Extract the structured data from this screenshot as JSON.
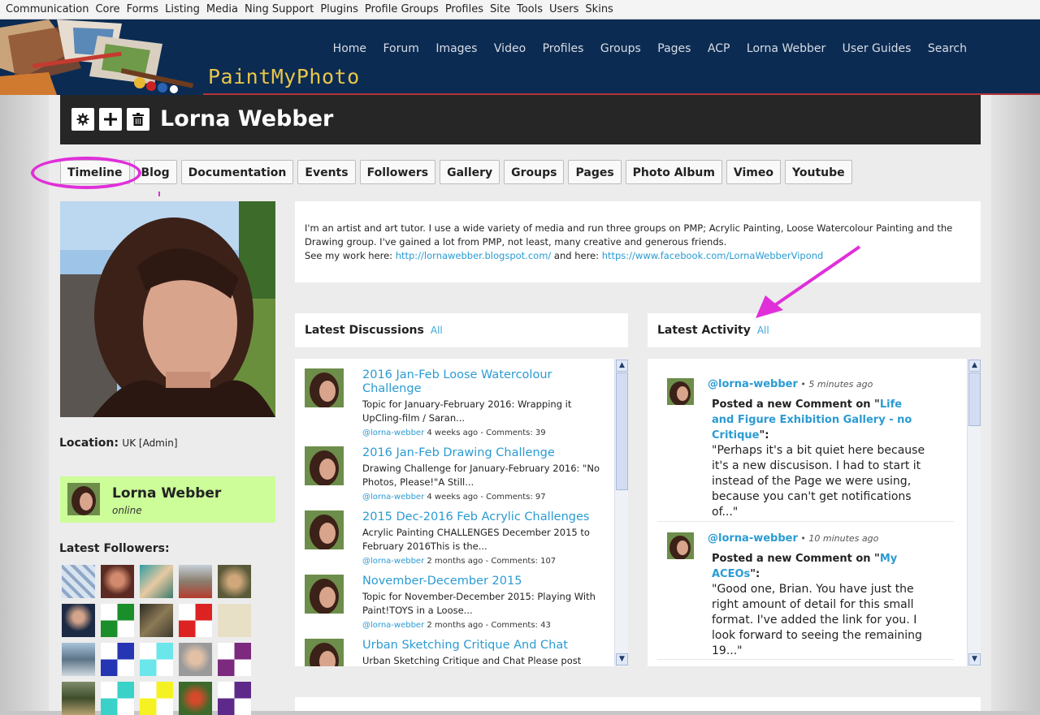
{
  "adminbar": {
    "items": [
      "Communication",
      "Core",
      "Forms",
      "Listing",
      "Media",
      "Ning Support",
      "Plugins",
      "Profile Groups",
      "Profiles",
      "Site",
      "Tools",
      "Users",
      "Skins"
    ]
  },
  "header": {
    "brand": "PaintMyPhoto",
    "nav": [
      "Home",
      "Forum",
      "Images",
      "Video",
      "Profiles",
      "Groups",
      "Pages",
      "ACP",
      "Lorna Webber",
      "User Guides",
      "Search"
    ]
  },
  "profile": {
    "name": "Lorna Webber",
    "tools": [
      "gear-icon",
      "plus-icon",
      "trash-icon"
    ],
    "tabs": [
      "Timeline",
      "Blog",
      "Documentation",
      "Events",
      "Followers",
      "Gallery",
      "Groups",
      "Pages",
      "Photo Album",
      "Vimeo",
      "Youtube"
    ],
    "location_label": "Location:",
    "location_value": "UK [Admin]",
    "online_name": "Lorna Webber",
    "online_status": "online",
    "followers_title": "Latest Followers:"
  },
  "bio": {
    "line1": "I'm an artist and art tutor.  I use a wide variety of media and run three groups on PMP; Acrylic Painting, Loose Watercolour Painting and the",
    "line2": "Drawing group.  I've gained a lot from PMP, not least, many creative and generous friends.",
    "line3_prefix": "See my work here: ",
    "link1": "http://lornawebber.blogspot.com/",
    "line3_mid": " and here: ",
    "link2": "https://www.facebook.com/LornaWebberVipond"
  },
  "discussions": {
    "title": "Latest Discussions",
    "all_label": "All",
    "items": [
      {
        "title": "2016 Jan-Feb Loose Watercolour Challenge",
        "excerpt": "Topic for January-February 2016: Wrapping it UpCling-film / Saran...",
        "user": "@lorna-webber",
        "meta": " 4 weeks ago - Comments: 39"
      },
      {
        "title": "2016 Jan-Feb Drawing Challenge",
        "excerpt": "Drawing Challenge for January-February 2016: \"No Photos, Please!\"A Still...",
        "user": "@lorna-webber",
        "meta": " 4 weeks ago - Comments: 97"
      },
      {
        "title": "2015 Dec-2016 Feb Acrylic Challenges",
        "excerpt": "Acrylic Painting CHALLENGES December 2015 to February 2016This is the...",
        "user": "@lorna-webber",
        "meta": " 2 months ago - Comments: 107"
      },
      {
        "title": "November-December 2015",
        "excerpt": "Topic for November-December 2015: Playing With Paint!TOYS in a Loose...",
        "user": "@lorna-webber",
        "meta": " 2 months ago - Comments: 43"
      },
      {
        "title": "Urban Sketching Critique And Chat",
        "excerpt": "Urban Sketching Critique and Chat Please post",
        "user": "",
        "meta": ""
      }
    ]
  },
  "activity": {
    "title": "Latest Activity",
    "all_label": "All",
    "items": [
      {
        "user": "@lorna-webber",
        "time": " • 5 minutes ago",
        "action": "Posted a new Comment on \"",
        "link": "Life and Figure Exhibition Gallery - no Critique",
        "after": "\":",
        "quote": "\"Perhaps it's a bit quiet here because it's a new discusison.  I had to start it instead of the Page we were using, because you can't get notifications of...\""
      },
      {
        "user": "@lorna-webber",
        "time": " • 10 minutes ago",
        "action": "Posted a new Comment on \"",
        "link": "My ACEOs",
        "after": "\":",
        "quote": "\"Good one, Brian.  You have just the right amount of detail for this small format. I've added the link for you.  I look forward to seeing the remaining 19...\""
      }
    ]
  },
  "colors": {
    "header_bg": "#0b2b52",
    "brand": "#e9c64a",
    "link": "#2a9bd3",
    "online_bg": "#ccfd99",
    "annotation": "#e02fd9"
  }
}
